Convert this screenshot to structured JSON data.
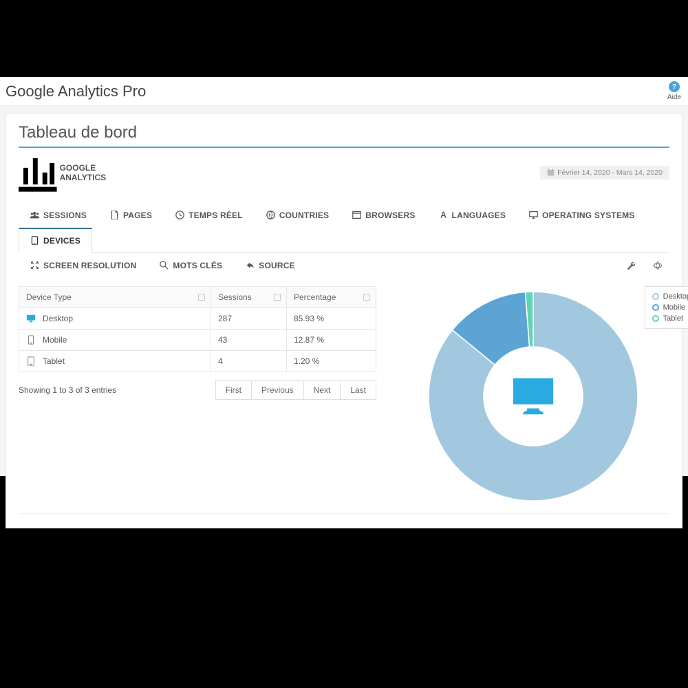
{
  "header": {
    "app_title": "Google Analytics Pro",
    "aide_label": "Aide"
  },
  "panel": {
    "dashboard_title": "Tableau de bord",
    "subhead": "GOOGLE ANALYTICS",
    "date_range": "Février 14, 2020 - Mars 14, 2020"
  },
  "tabs": {
    "row1": [
      {
        "label": "SESSIONS"
      },
      {
        "label": "PAGES"
      },
      {
        "label": "TEMPS RÉEL"
      },
      {
        "label": "COUNTRIES"
      },
      {
        "label": "BROWSERS"
      },
      {
        "label": "LANGUAGES"
      },
      {
        "label": "OPERATING SYSTEMS"
      },
      {
        "label": "DEVICES"
      }
    ],
    "row2": [
      {
        "label": "SCREEN RESOLUTION"
      },
      {
        "label": "MOTS CLÉS"
      },
      {
        "label": "SOURCE"
      }
    ],
    "active": "DEVICES"
  },
  "table": {
    "headers": [
      "Device Type",
      "Sessions",
      "Percentage"
    ],
    "rows": [
      {
        "device": "Desktop",
        "sessions": "287",
        "percentage": "85.93 %",
        "color": "#29abe2"
      },
      {
        "device": "Mobile",
        "sessions": "43",
        "percentage": "12.87 %",
        "color": "#888"
      },
      {
        "device": "Tablet",
        "sessions": "4",
        "percentage": "1.20 %",
        "color": "#888"
      }
    ],
    "showing": "Showing 1 to 3 of 3 entries",
    "pager": {
      "first": "First",
      "previous": "Previous",
      "next": "Next",
      "last": "Last"
    }
  },
  "legend": [
    {
      "label": "Desktop",
      "color": "#a2c8e0"
    },
    {
      "label": "Mobile",
      "color": "#5ba4d4"
    },
    {
      "label": "Tablet",
      "color": "#5fd4b1"
    }
  ],
  "chart_data": {
    "type": "pie",
    "title": "",
    "series": [
      {
        "name": "Desktop",
        "value": 85.93,
        "color": "#a2c8e0"
      },
      {
        "name": "Mobile",
        "value": 12.87,
        "color": "#5ba4d4"
      },
      {
        "name": "Tablet",
        "value": 1.2,
        "color": "#5fd4b1"
      }
    ],
    "donut": true
  }
}
